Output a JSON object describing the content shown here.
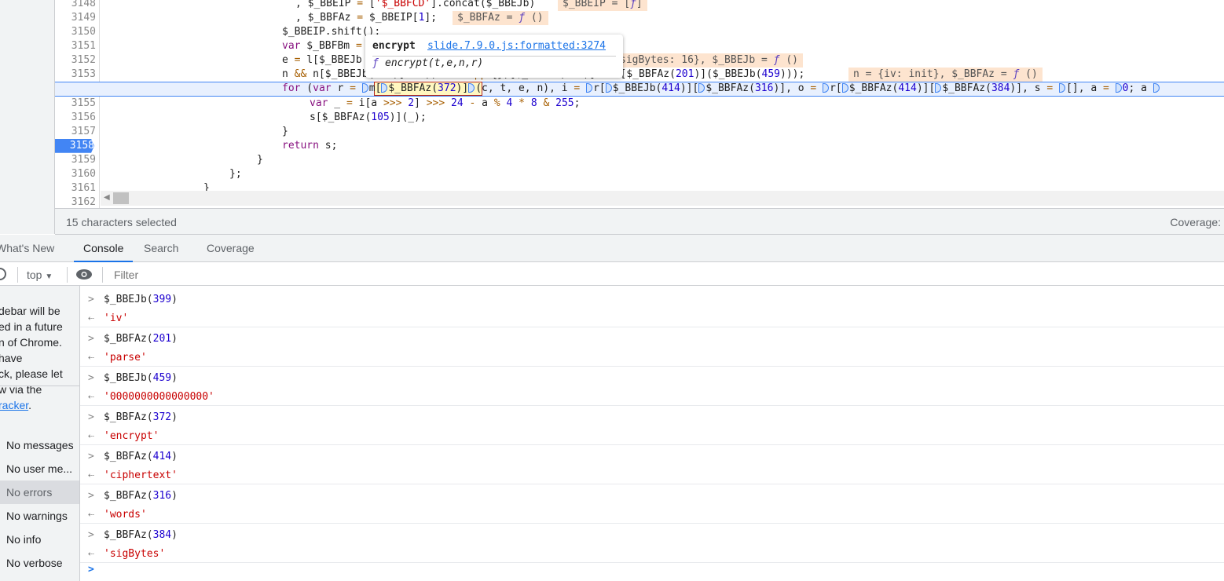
{
  "editor": {
    "lines": [
      {
        "n": "3148",
        "text": ", $_BBEIP = ['$_BBFCD'].concat($_BBEJb)",
        "value": "$_BBEIP = [ƒ]"
      },
      {
        "n": "3149",
        "text": ", $_BBFAz = $_BBEIP[1];",
        "value": "$_BBFAz = ƒ ()"
      },
      {
        "n": "3150",
        "text": "$_BBEIP.shift();"
      },
      {
        "n": "3151",
        "text": "var $_BBFBm = "
      },
      {
        "n": "3152",
        "text": "e = l[$_BBEJb",
        "value": "sigBytes: 16}, $_BBEJb = ƒ ()"
      },
      {
        "n": "3153",
        "text": "n && n[$_BBEJb(399)] = ((n = n || {})[$_BBFAz(399)] = l[$_BBFAz(201)]($_BBEJb(459)));",
        "value": "n = {iv: init}, $_BBFAz = ƒ ()"
      },
      {
        "n": "3154",
        "text": "for (var r = §m[§$_BBFAz(372)]§(c, t, e, n), i = §r[§$_BBEJb(414)][§$_BBFAz(316)], o = §r[§$_BBFAz(414)][§$_BBFAz(384)], s = §[], a = §0; a §",
        "breakpoint": true,
        "current": true
      },
      {
        "n": "3155",
        "text": "var _ = i[a >>> 2] >>> 24 - a % 4 * 8 & 255;"
      },
      {
        "n": "3156",
        "text": "s[$_BBFAz(105)](_);"
      },
      {
        "n": "3157",
        "text": "}"
      },
      {
        "n": "3158",
        "text": "return s;",
        "breakpoint": true
      },
      {
        "n": "3159",
        "text": "}"
      },
      {
        "n": "3160",
        "text": "};"
      },
      {
        "n": "3161",
        "text": "}"
      },
      {
        "n": "3162",
        "text": ""
      }
    ],
    "tooltip": {
      "title": "encrypt",
      "link": "slide.7.9.0.js:formatted:3274",
      "signature_icon": "ƒ",
      "signature": "encrypt(t,e,n,r)"
    }
  },
  "status": {
    "selection": "15 characters selected",
    "coverage": "Coverage:"
  },
  "drawer_tabs": [
    {
      "label": "What's New"
    },
    {
      "label": "Console",
      "active": true
    },
    {
      "label": "Search"
    },
    {
      "label": "Coverage"
    }
  ],
  "toolbar": {
    "context": "top",
    "filter_placeholder": "Filter"
  },
  "sidebar": {
    "notice": [
      "debar will be",
      "ed in a future",
      "n of Chrome.",
      "have",
      "ck, please let",
      "w via the"
    ],
    "notice_link": "racker",
    "notice_link_suffix": ".",
    "items": [
      {
        "label": "No messages"
      },
      {
        "label": "No user me..."
      },
      {
        "label": "No errors",
        "selected": true
      },
      {
        "label": "No warnings"
      },
      {
        "label": "No info"
      },
      {
        "label": "No verbose"
      }
    ]
  },
  "console": [
    {
      "input": "$_BBEJb(399)",
      "output": "'iv'"
    },
    {
      "input": "$_BBFAz(201)",
      "output": "'parse'"
    },
    {
      "input": "$_BBEJb(459)",
      "output": "'0000000000000000'"
    },
    {
      "input": "$_BBFAz(372)",
      "output": "'encrypt'"
    },
    {
      "input": "$_BBFAz(414)",
      "output": "'ciphertext'"
    },
    {
      "input": "$_BBFAz(316)",
      "output": "'words'"
    },
    {
      "input": "$_BBFAz(384)",
      "output": "'sigBytes'"
    }
  ],
  "colors": {
    "accent": "#1a73e8",
    "string": "#c80000",
    "number": "#1c00cf",
    "keyword": "#881280"
  }
}
